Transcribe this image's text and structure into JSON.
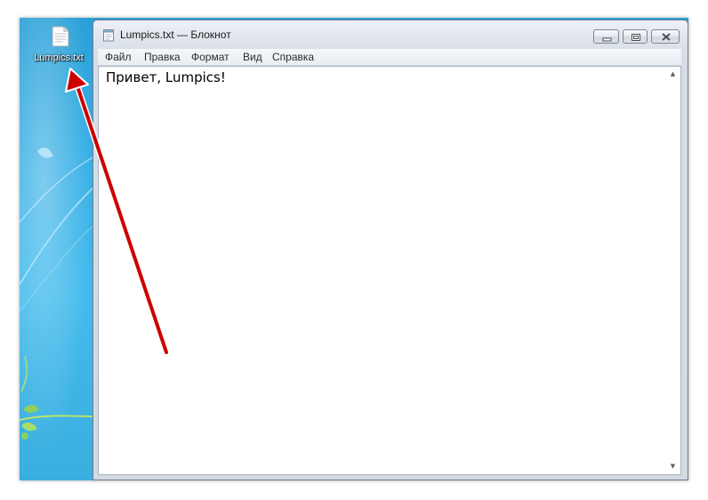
{
  "desktop": {
    "icon_label": "Lumpics.txt",
    "icon_name": "text-file-icon"
  },
  "window": {
    "title": "Lumpics.txt — Блокнот",
    "minimize_icon": "minimize-icon",
    "maximize_icon": "restore-icon",
    "close_icon": "close-icon"
  },
  "menu": {
    "file": "Файл",
    "edit": "Правка",
    "format": "Формат",
    "view": "Вид",
    "help": "Справка"
  },
  "editor": {
    "content": "Привет, Lumpics!"
  },
  "annotation": {
    "arrow_color": "#cc0000",
    "arrow_icon": "pointer-arrow"
  }
}
